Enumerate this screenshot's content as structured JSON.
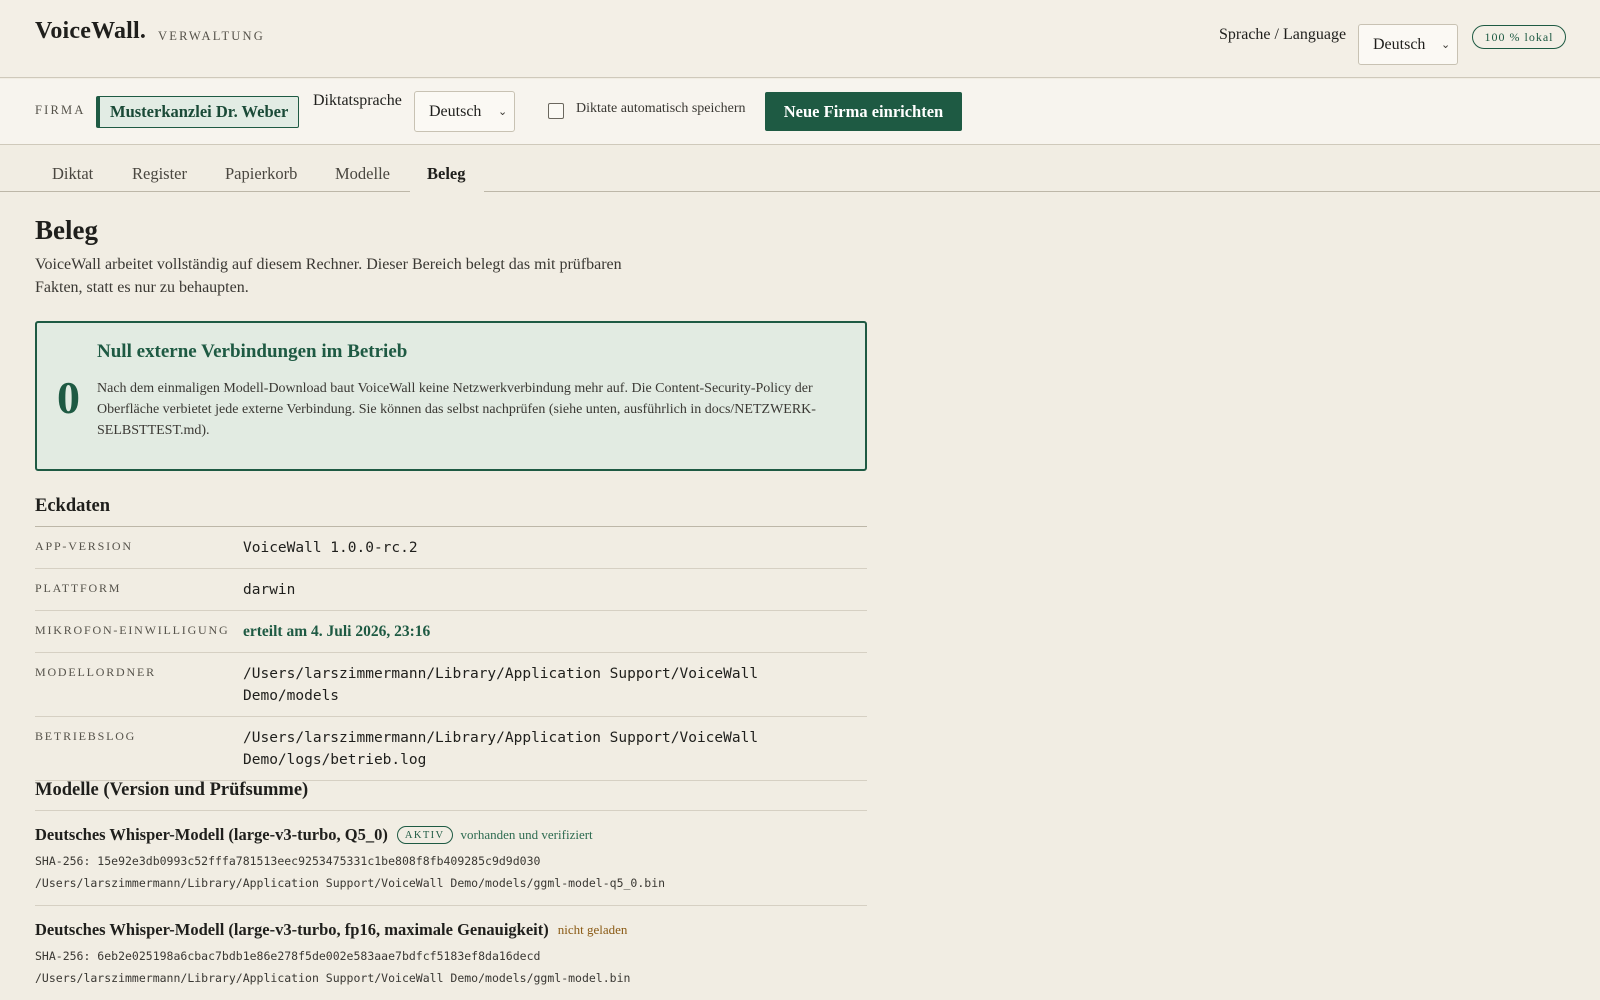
{
  "header": {
    "brand": "VoiceWall.",
    "brand_sub": "VERWALTUNG",
    "language_label": "Sprache / Language",
    "language_value": "Deutsch",
    "local_badge": "100 % lokal"
  },
  "firmbar": {
    "firm_label": "FIRMA",
    "firm_name": "Musterkanzlei Dr. Weber",
    "dictation_language_label": "Diktatsprache",
    "dictation_language_value": "Deutsch",
    "autosave_label": "Diktate automatisch speichern",
    "new_firm_button": "Neue Firma einrichten"
  },
  "tabs": [
    {
      "label": "Diktat"
    },
    {
      "label": "Register"
    },
    {
      "label": "Papierkorb"
    },
    {
      "label": "Modelle"
    },
    {
      "label": "Beleg"
    }
  ],
  "page": {
    "title": "Beleg",
    "intro": "VoiceWall arbeitet vollständig auf diesem Rechner. Dieser Bereich belegt das mit prüfbaren Fakten, statt es nur zu behaupten."
  },
  "zero_card": {
    "number": "0",
    "title": "Null externe Verbindungen im Betrieb",
    "text": "Nach dem einmaligen Modell-Download baut VoiceWall keine Netzwerkverbindung mehr auf. Die Content-Security-Policy der Oberfläche verbietet jede externe Verbindung. Sie können das selbst nachprüfen (siehe unten, ausführlich in docs/NETZWERK-SELBSTTEST.md)."
  },
  "facts": {
    "title": "Eckdaten",
    "rows": [
      {
        "key": "APP-VERSION",
        "value": "VoiceWall 1.0.0-rc.2"
      },
      {
        "key": "PLATTFORM",
        "value": "darwin"
      },
      {
        "key": "MIKROFON-EINWILLIGUNG",
        "value": "erteilt am 4. Juli 2026, 23:16"
      },
      {
        "key": "MODELLORDNER",
        "value": "/Users/larszimmermann/Library/Application Support/VoiceWall Demo/models"
      },
      {
        "key": "BETRIEBSLOG",
        "value": "/Users/larszimmermann/Library/Application Support/VoiceWall Demo/logs/betrieb.log"
      }
    ]
  },
  "models": {
    "title": "Modelle (Version und Prüfsumme)",
    "items": [
      {
        "name": "Deutsches Whisper-Modell (large-v3-turbo, Q5_0)",
        "badge": "AKTIV",
        "status": "vorhanden und verifiziert",
        "sha": "SHA-256: 15e92e3db0993c52fffa781513eec9253475331c1be808f8fb409285c9d9d030",
        "path": "/Users/larszimmermann/Library/Application Support/VoiceWall Demo/models/ggml-model-q5_0.bin"
      },
      {
        "name": "Deutsches Whisper-Modell (large-v3-turbo, fp16, maximale Genauigkeit)",
        "status": "nicht geladen",
        "sha": "SHA-256: 6eb2e025198a6cbac7bdb1e86e278f5de002e583aae7bdfcf5183ef8da16decd",
        "path": "/Users/larszimmermann/Library/Application Support/VoiceWall Demo/models/ggml-model.bin"
      }
    ]
  }
}
